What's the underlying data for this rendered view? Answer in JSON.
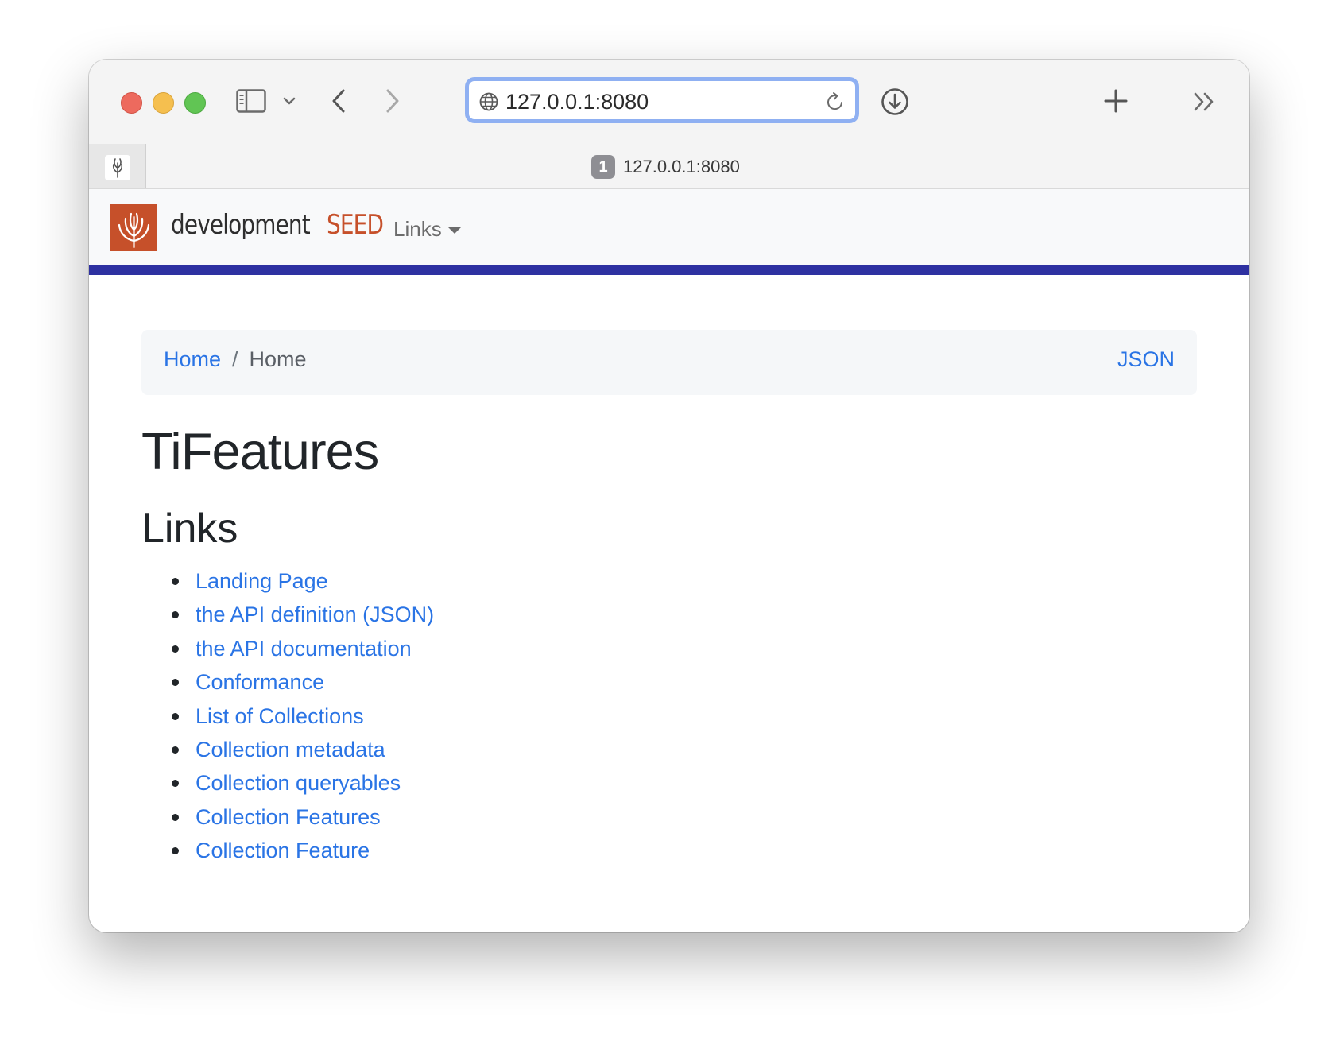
{
  "browser": {
    "address_url": "127.0.0.1:8080",
    "tab_count": "1",
    "tab_title": "127.0.0.1:8080"
  },
  "navbar": {
    "brand_part1": "development",
    "brand_part2": "SEED",
    "links_label": "Links",
    "brand_color": "#c6502a",
    "stripe_color": "#2e31a1"
  },
  "breadcrumb": {
    "home_link": "Home",
    "separator": "/",
    "current": "Home",
    "json_link": "JSON"
  },
  "main": {
    "title": "TiFeatures",
    "links_heading": "Links",
    "links": [
      "Landing Page",
      "the API definition (JSON)",
      "the API documentation",
      "Conformance",
      "List of Collections",
      "Collection metadata",
      "Collection queryables",
      "Collection Features",
      "Collection Feature"
    ],
    "link_color": "#2a74e5"
  }
}
